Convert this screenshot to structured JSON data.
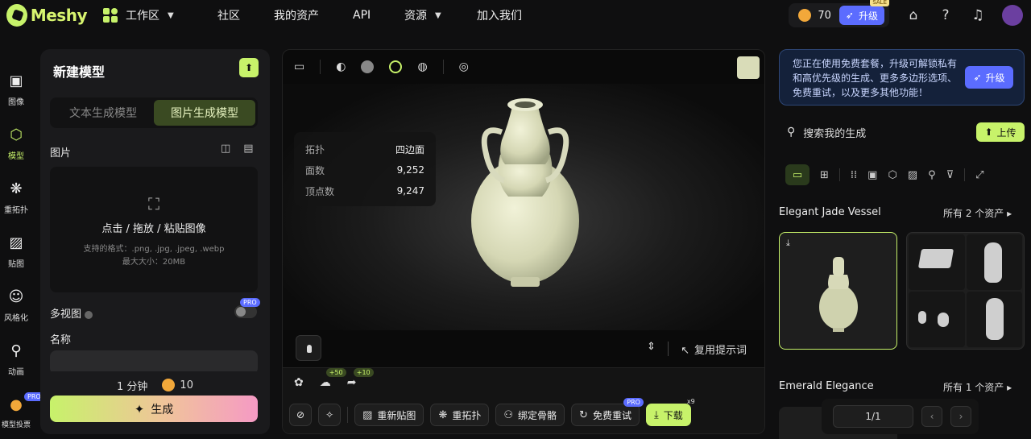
{
  "app": {
    "logo_text": "Meshy",
    "accent": "#c7f26a"
  },
  "nav": {
    "workspace": "工作区",
    "items": [
      "社区",
      "我的资产",
      "API",
      "资源",
      "加入我们"
    ]
  },
  "topbar": {
    "credits": "70",
    "upgrade": "升级",
    "sale_badge": "SALE"
  },
  "rail": [
    {
      "label": "图像",
      "icon": "image-icon"
    },
    {
      "label": "模型",
      "icon": "cube-icon"
    },
    {
      "label": "重拓扑",
      "icon": "retopo-icon"
    },
    {
      "label": "贴图",
      "icon": "texture-icon"
    },
    {
      "label": "风格化",
      "icon": "stylize-icon"
    },
    {
      "label": "动画",
      "icon": "running-icon"
    },
    {
      "label": "模型投票",
      "icon": "vote-icon",
      "badge": "PRO"
    }
  ],
  "panel": {
    "title": "新建模型",
    "tabs": [
      "文本生成模型",
      "图片生成模型"
    ],
    "active_tab": 1,
    "image_label": "图片",
    "drop_text": "点击 / 拖放 / 粘贴图像",
    "formats": "支持的格式：.png, .jpg, .jpeg, .webp",
    "max_size": "最大大小：20MB",
    "multiview_label": "多视图",
    "multiview_badge": "PRO",
    "name_label": "名称",
    "time": "1 分钟",
    "cost": "10",
    "generate": "生成"
  },
  "viewer": {
    "stats": [
      {
        "key": "拓扑",
        "value": "四边面"
      },
      {
        "key": "面数",
        "value": "9,252"
      },
      {
        "key": "顶点数",
        "value": "9,247"
      }
    ],
    "reuse_prompt": "复用提示词",
    "like_badge": "+50",
    "share_badge": "+10",
    "actions": {
      "retexture": "重新贴图",
      "remesh": "重拓扑",
      "rig": "绑定骨骼",
      "free_retry": "免费重试",
      "free_retry_badge": "PRO",
      "download": "下载",
      "download_badge": "x9"
    }
  },
  "right": {
    "promo": "您正在使用免费套餐，升级可解锁私有和高优先级的生成、更多多边形选项、免费重试，以及更多其他功能！",
    "promo_button": "升级",
    "search_placeholder": "搜索我的生成",
    "upload": "上传",
    "sections": [
      {
        "title": "Elegant Jade Vessel",
        "all": "所有 2 个资产"
      },
      {
        "title": "Emerald Elegance",
        "all": "所有 1 个资产"
      }
    ],
    "pager": "1/1"
  }
}
